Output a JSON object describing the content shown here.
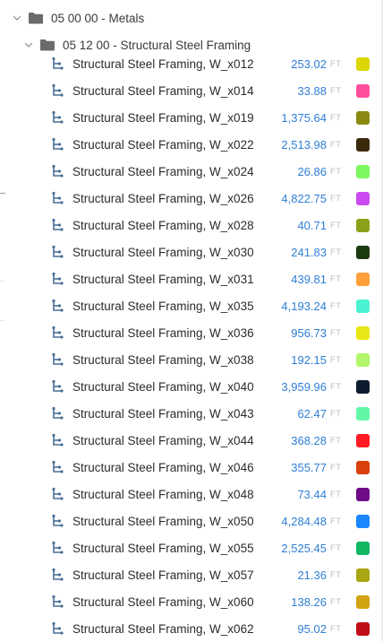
{
  "tree": {
    "level1": {
      "label": "05 00 00 - Metals",
      "icon": "folder-icon"
    },
    "level2": {
      "label": "05 12 00 - Structural Steel Framing",
      "icon": "folder-icon"
    }
  },
  "items": [
    {
      "name": "Structural Steel Framing, W_x012",
      "value": "253.02",
      "unit": "FT",
      "color": "#dcd600"
    },
    {
      "name": "Structural Steel Framing, W_x014",
      "value": "33.88",
      "unit": "FT",
      "color": "#ff4f9a"
    },
    {
      "name": "Structural Steel Framing, W_x019",
      "value": "1,375.64",
      "unit": "FT",
      "color": "#8a8a12"
    },
    {
      "name": "Structural Steel Framing, W_x022",
      "value": "2,513.98",
      "unit": "FT",
      "color": "#3a2a0c"
    },
    {
      "name": "Structural Steel Framing, W_x024",
      "value": "26.86",
      "unit": "FT",
      "color": "#7cf760"
    },
    {
      "name": "Structural Steel Framing, W_x026",
      "value": "4,822.75",
      "unit": "FT",
      "color": "#cc4bf0"
    },
    {
      "name": "Structural Steel Framing, W_x028",
      "value": "40.71",
      "unit": "FT",
      "color": "#8aa21a"
    },
    {
      "name": "Structural Steel Framing, W_x030",
      "value": "241.83",
      "unit": "FT",
      "color": "#1b3a10"
    },
    {
      "name": "Structural Steel Framing, W_x031",
      "value": "439.81",
      "unit": "FT",
      "color": "#ff9f3a"
    },
    {
      "name": "Structural Steel Framing, W_x035",
      "value": "4,193.24",
      "unit": "FT",
      "color": "#4cf2d2"
    },
    {
      "name": "Structural Steel Framing, W_x036",
      "value": "956.73",
      "unit": "FT",
      "color": "#e8e616"
    },
    {
      "name": "Structural Steel Framing, W_x038",
      "value": "192.15",
      "unit": "FT",
      "color": "#b2f56a"
    },
    {
      "name": "Structural Steel Framing, W_x040",
      "value": "3,959.96",
      "unit": "FT",
      "color": "#0c1a2e"
    },
    {
      "name": "Structural Steel Framing, W_x043",
      "value": "62.47",
      "unit": "FT",
      "color": "#62f7a8"
    },
    {
      "name": "Structural Steel Framing, W_x044",
      "value": "368.28",
      "unit": "FT",
      "color": "#ff1a24"
    },
    {
      "name": "Structural Steel Framing, W_x046",
      "value": "355.77",
      "unit": "FT",
      "color": "#d8400c"
    },
    {
      "name": "Structural Steel Framing, W_x048",
      "value": "73.44",
      "unit": "FT",
      "color": "#6e0a86"
    },
    {
      "name": "Structural Steel Framing, W_x050",
      "value": "4,284.48",
      "unit": "FT",
      "color": "#1a86ff"
    },
    {
      "name": "Structural Steel Framing, W_x055",
      "value": "2,525.45",
      "unit": "FT",
      "color": "#10b864"
    },
    {
      "name": "Structural Steel Framing, W_x057",
      "value": "21.36",
      "unit": "FT",
      "color": "#a8a612"
    },
    {
      "name": "Structural Steel Framing, W_x060",
      "value": "138.26",
      "unit": "FT",
      "color": "#d2a414"
    },
    {
      "name": "Structural Steel Framing, W_x062",
      "value": "95.02",
      "unit": "FT",
      "color": "#c00e16"
    }
  ],
  "icons": {
    "chevron": "chevron-down-icon",
    "item": "structural-element-icon"
  }
}
